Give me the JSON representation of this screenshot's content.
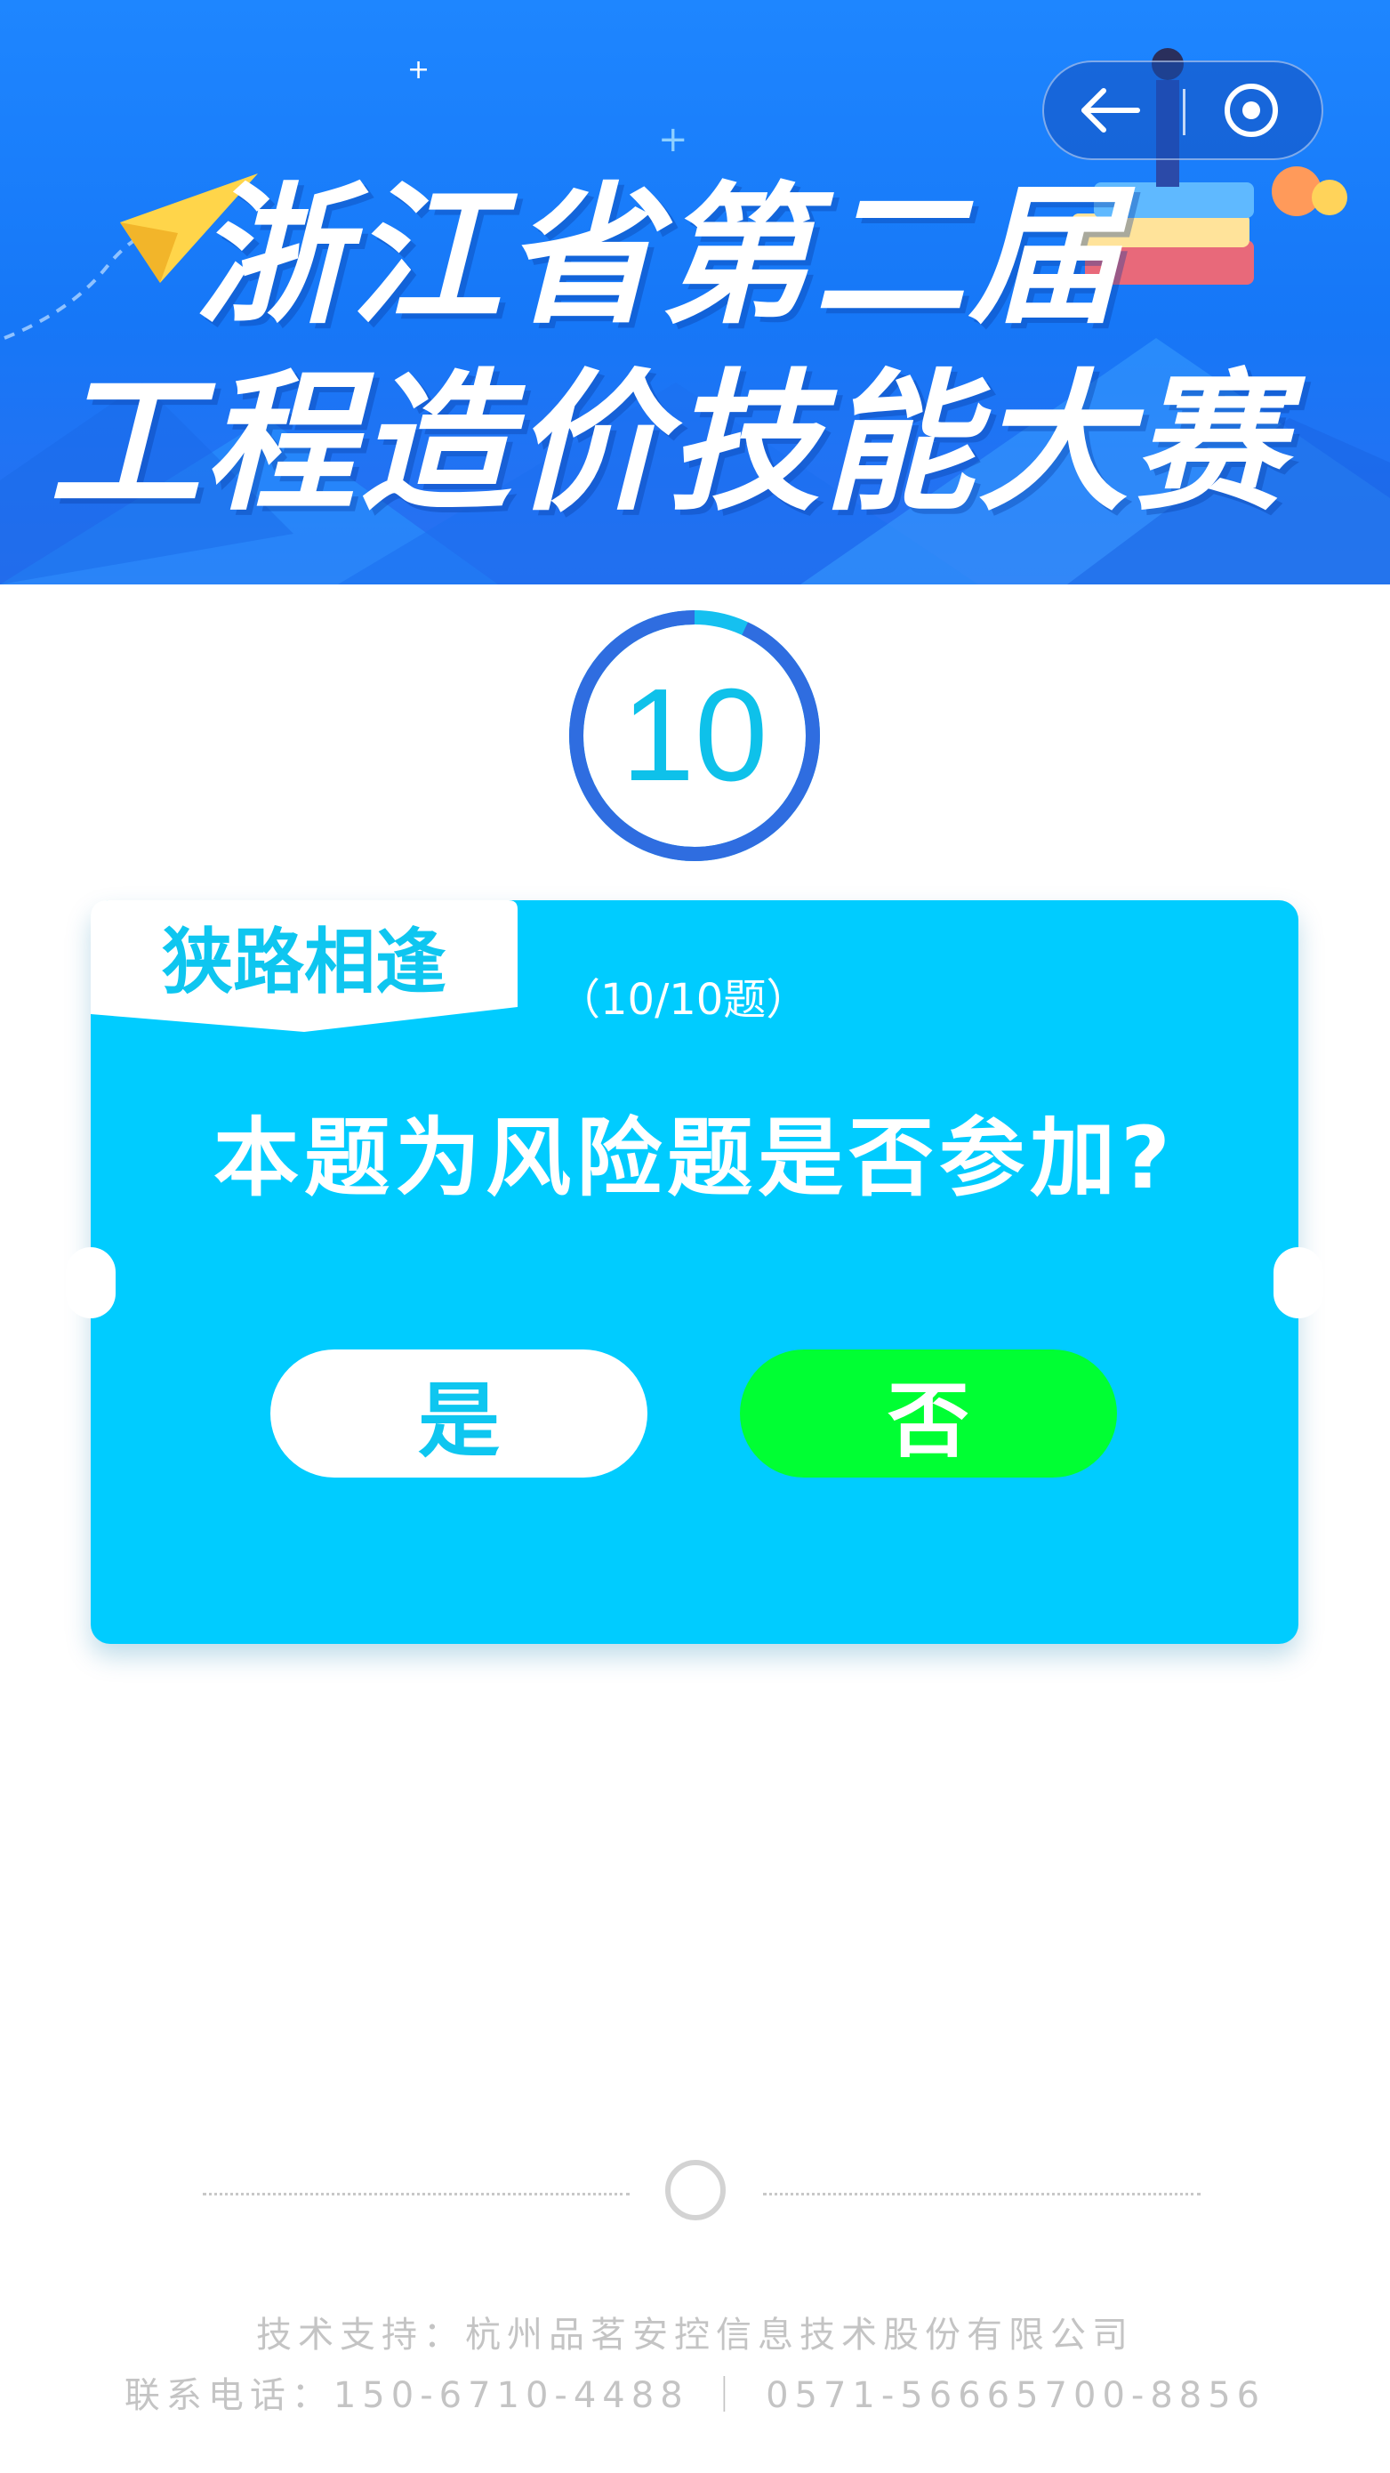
{
  "banner": {
    "title_line1": "浙江省第二届",
    "title_line2": "工程造价技能大赛"
  },
  "capsule": {
    "back_icon": "back-arrow-icon",
    "home_icon": "target-circle-icon"
  },
  "timer": {
    "seconds": "10",
    "remaining_fraction": 0.93
  },
  "card": {
    "tag": "狭路相逢",
    "progress": "（10/10题）",
    "question": "本题为风险题是否参加?",
    "yes_label": "是",
    "no_label": "否"
  },
  "footer": {
    "support": "技术支持：杭州品茗安控信息技术股份有限公司",
    "contact": "联系电话：150-6710-4488 ｜ 0571-56665700-8856"
  },
  "colors": {
    "banner_blue": "#1677f7",
    "card_cyan": "#00ccff",
    "yes_button": "#ffffff",
    "no_button": "#00ff33",
    "timer_ring": "#2f6de0",
    "timer_text": "#0ec1ea"
  }
}
